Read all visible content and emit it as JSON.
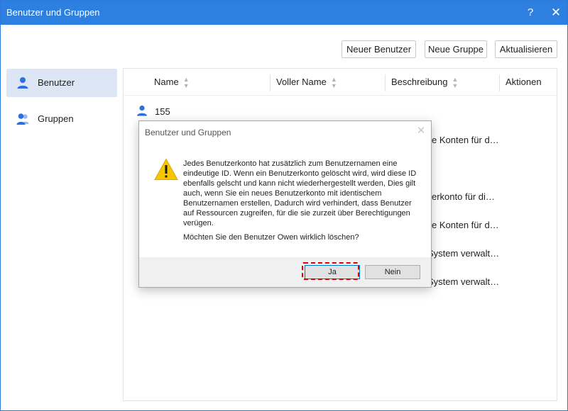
{
  "window": {
    "title": "Benutzer und Gruppen",
    "help_glyph": "?",
    "close_glyph": "✕"
  },
  "toolbar": {
    "new_user": "Neuer Benutzer",
    "new_group": "Neue Gruppe",
    "refresh": "Aktualisieren"
  },
  "sidebar": {
    "items": [
      {
        "label": "Benutzer",
        "icon": "user-icon",
        "active": true
      },
      {
        "label": "Gruppen",
        "icon": "group-icon",
        "active": false
      }
    ]
  },
  "table": {
    "columns": [
      "Name",
      "Voller Name",
      "Beschreibung",
      "Aktionen"
    ],
    "first_row_name": "155",
    "visible_descriptions": [
      "e Konten für d…",
      "erkonto für di…",
      "e Konten für d…",
      "System verwalt…",
      "System verwalt…"
    ]
  },
  "dialog": {
    "title": "Benutzer und Gruppen",
    "close_glyph": "✕",
    "message": "Jedes Benutzerkonto hat zusätzlich zum Benutzernamen eine eindeutige ID. Wenn ein Benutzerkonto gelöscht wird, wird diese ID ebenfalls gelscht und kann nicht wiederhergestellt werden, Dies gilt auch, wenn Sie ein neues Benutzerkonto mit identischem Benutzernamen erstellen, Dadurch wird verhindert, dass Benutzer auf Ressourcen zugreifen, für die sie zurzeit über Berechtigungen verügen.",
    "question": "Möchten Sie den Benutzer Owen wirklich löschen?",
    "yes": "Ja",
    "no": "Nein"
  },
  "colors": {
    "titlebar": "#2d7fe0",
    "accent": "#2b6fe0",
    "highlight": "#e00000",
    "sidebar_active": "#dce6f5"
  }
}
